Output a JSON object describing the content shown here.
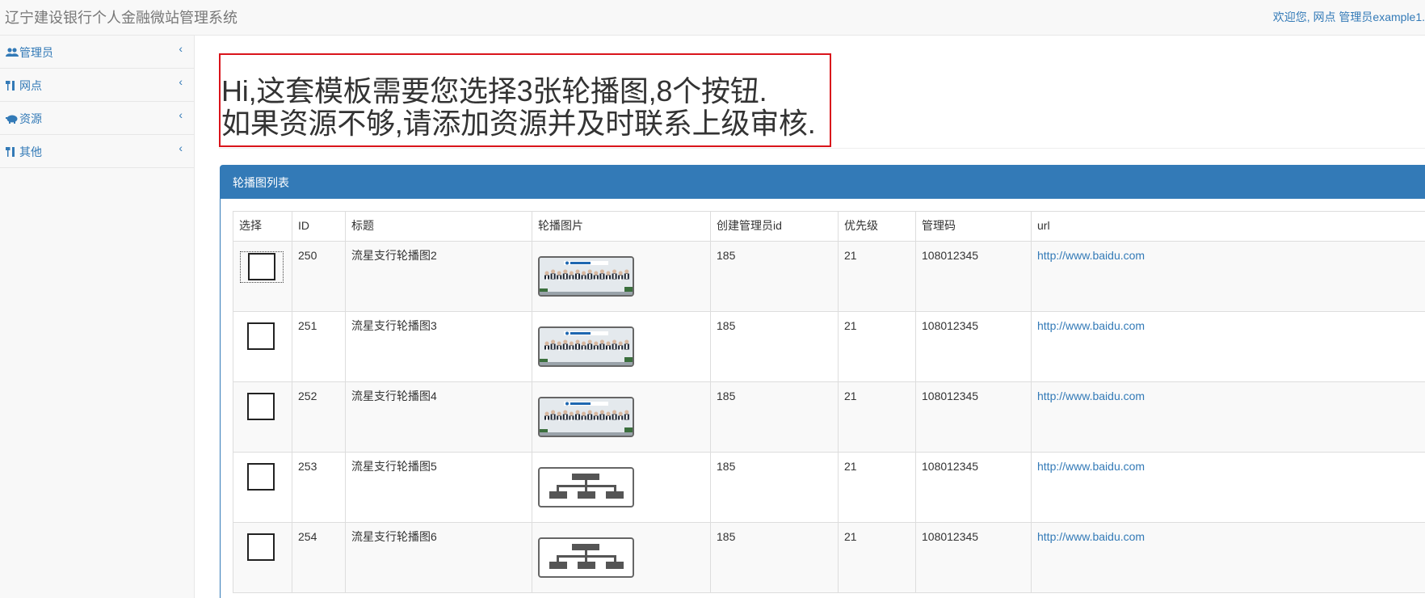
{
  "header": {
    "title": "辽宁建设银行个人金融微站管理系统",
    "welcome": "欢迎您, 网点 管理员example1."
  },
  "sidebar": {
    "items": [
      {
        "label": "管理员",
        "icon": "users-icon"
      },
      {
        "label": "网点",
        "icon": "cutlery-icon"
      },
      {
        "label": "资源",
        "icon": "piggy-bank-icon"
      },
      {
        "label": "其他",
        "icon": "cutlery-icon"
      }
    ],
    "chevron": "‹"
  },
  "notice": {
    "line1": "Hi,这套模板需要您选择3张轮播图,8个按钮.",
    "line2": "如果资源不够,请添加资源并及时联系上级审核."
  },
  "panel": {
    "title": "轮播图列表",
    "columns": [
      "选择",
      "ID",
      "标题",
      "轮播图片",
      "创建管理员id",
      "优先级",
      "管理码",
      "url"
    ],
    "rows": [
      {
        "id": "250",
        "title": "流星支行轮播图2",
        "image": "photo",
        "creator_id": "185",
        "priority": "21",
        "code": "108012345",
        "url": "http://www.baidu.com"
      },
      {
        "id": "251",
        "title": "流星支行轮播图3",
        "image": "photo",
        "creator_id": "185",
        "priority": "21",
        "code": "108012345",
        "url": "http://www.baidu.com"
      },
      {
        "id": "252",
        "title": "流星支行轮播图4",
        "image": "photo",
        "creator_id": "185",
        "priority": "21",
        "code": "108012345",
        "url": "http://www.baidu.com"
      },
      {
        "id": "253",
        "title": "流星支行轮播图5",
        "image": "org-chart",
        "creator_id": "185",
        "priority": "21",
        "code": "108012345",
        "url": "http://www.baidu.com"
      },
      {
        "id": "254",
        "title": "流星支行轮播图6",
        "image": "org-chart",
        "creator_id": "185",
        "priority": "21",
        "code": "108012345",
        "url": "http://www.baidu.com"
      }
    ]
  },
  "colors": {
    "primary": "#337ab7",
    "notice_border": "#d9141b",
    "topbar_bg": "#f8f8f8"
  }
}
